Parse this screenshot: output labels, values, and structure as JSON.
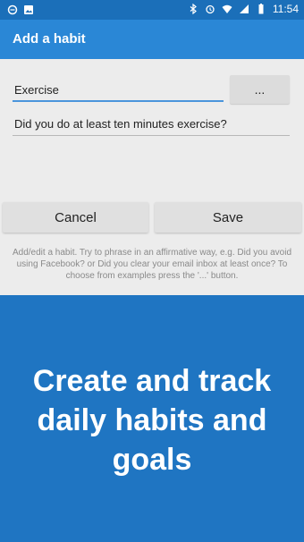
{
  "status_bar": {
    "time": "11:54",
    "left_icons": [
      "circle-notification-icon",
      "image-notification-icon"
    ],
    "right_icons": [
      "bluetooth-icon",
      "alarm-icon",
      "wifi-icon",
      "cellular-signal-icon",
      "battery-icon"
    ]
  },
  "app_bar": {
    "title": "Add a habit"
  },
  "form": {
    "name_value": "Exercise",
    "examples_button_label": "...",
    "question_value": "Did you do at least ten minutes exercise?",
    "cancel_label": "Cancel",
    "save_label": "Save",
    "help_text": "Add/edit a habit. Try to phrase in an affirmative way, e.g. Did you avoid using Facebook? or Did you clear your email inbox at least once? To choose from examples press the '...' button."
  },
  "promo": {
    "line1": "Create and track",
    "line2": "daily habits and",
    "line3": "goals"
  },
  "colors": {
    "status_bar": "#1b6fb9",
    "app_bar": "#2a87d6",
    "background": "#1f75c2",
    "sheet": "#ececec",
    "accent_underline": "#4a95dc"
  }
}
